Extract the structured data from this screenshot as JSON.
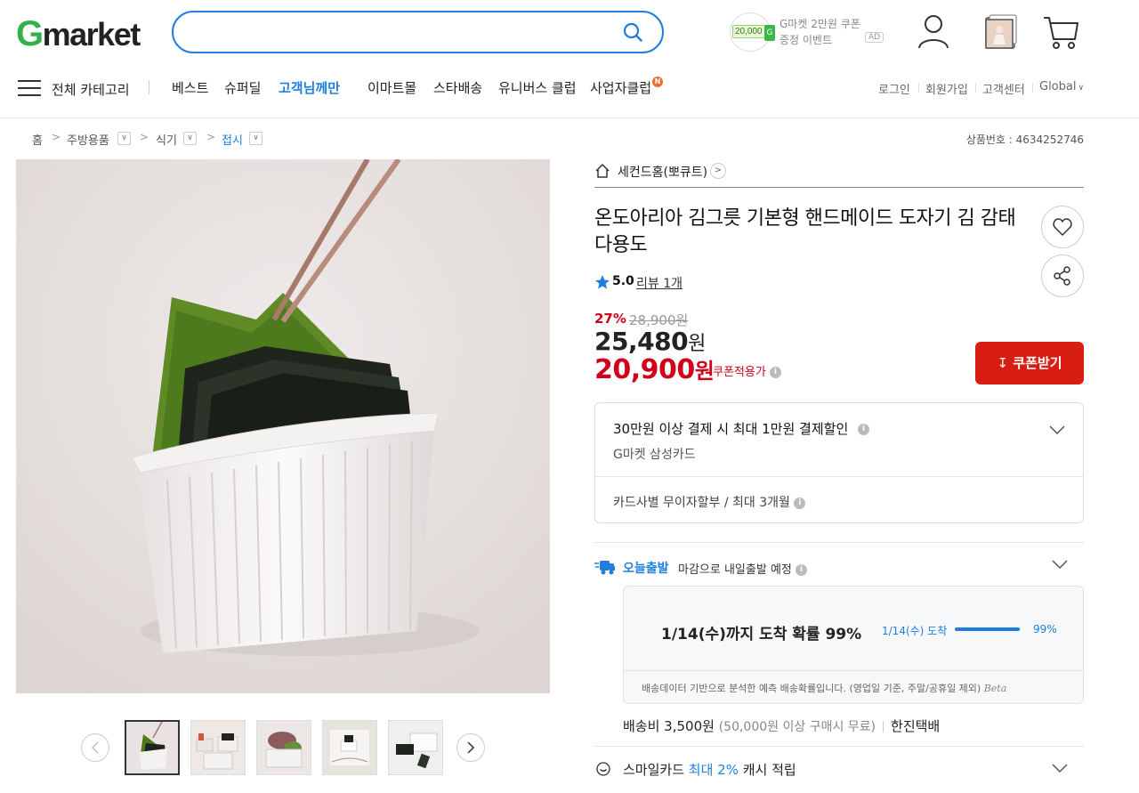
{
  "header": {
    "logo_g": "G",
    "logo_rest": "market",
    "search_placeholder": "",
    "promo": {
      "amount": "20,000",
      "coin_g": "G",
      "line1": "G마켓 2만원 쿠폰",
      "line2": "증정 이벤트",
      "ad": "AD"
    }
  },
  "nav": {
    "category_label": "전체 카테고리",
    "items": [
      {
        "label": "베스트"
      },
      {
        "label": "슈퍼딜"
      },
      {
        "label": "고객님께만"
      },
      {
        "label": "이마트몰"
      },
      {
        "label": "스타배송"
      },
      {
        "label": "유니버스 클럽"
      },
      {
        "label": "사업자클럽"
      }
    ],
    "new_badge": "N",
    "util": [
      "로그인",
      "회원가입",
      "고객센터",
      "Global"
    ]
  },
  "breadcrumb": {
    "items": [
      "홈",
      "주방용품",
      "식기",
      "접시"
    ],
    "product_no": "상품번호 : 4634252746"
  },
  "product": {
    "shop_name": "세컨드홈(뽀큐트)",
    "title": "온도아리아 김그릇 기본형 핸드메이드 도자기 김 감태 다용도",
    "rating": "5.0",
    "review_label": "리뷰 1개",
    "discount": "27%",
    "original_price": "28,900원",
    "price_num": "25,480",
    "price_unit": "원",
    "coupon_price_num": "20,900",
    "coupon_price_unit": "원",
    "coupon_label": "쿠폰적용가",
    "coupon_button": "쿠폰받기"
  },
  "card": {
    "title": "30만원 이상 결제 시 최대 1만원 결제할인",
    "sub": "G마켓 삼성카드",
    "installment": "카드사별 무이자할부 / 최대 3개월"
  },
  "shipping": {
    "badge": "오늘출발",
    "desc": "마감으로 내일출발 예정",
    "probability_text": "1/14(수)까지 도착 확률 99%",
    "bar_label": "1/14(수) 도착",
    "bar_value": 0.99,
    "bar_pct": "99%",
    "note": "배송데이터 기반으로 분석한 예측 배송확률입니다. (영업일 기준, 주말/공휴일 제외)",
    "beta": "Beta",
    "fee": "배송비 3,500원",
    "fee_cond": "(50,000원 이상 구매시 무료)",
    "carrier": "한진택배"
  },
  "smile": {
    "pre": "스마일카드 ",
    "highlight": "최대 2%",
    "post": " 캐시 적립"
  },
  "info_glyph": "i",
  "colors": {
    "accent": "#1f7ede",
    "sale": "#d0021b",
    "coupon_btn": "#d81e12",
    "logo_g": "#2fb34a"
  }
}
